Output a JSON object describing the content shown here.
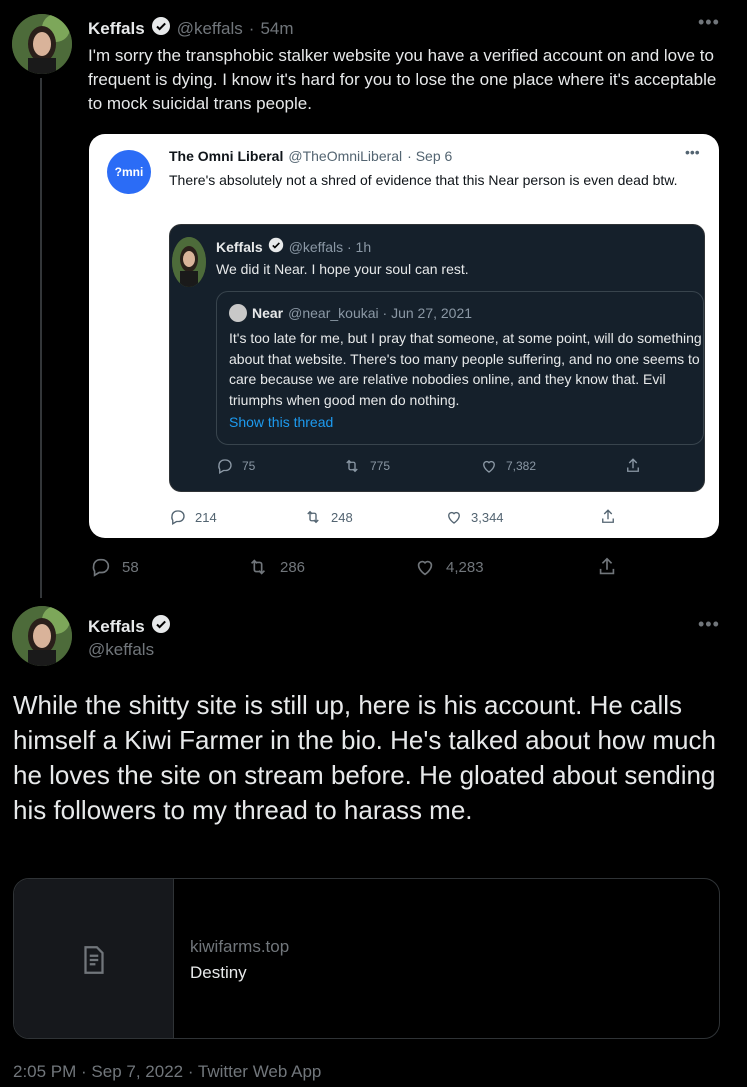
{
  "tweet1": {
    "name": "Keffals",
    "handle": "@keffals",
    "sep": "·",
    "time": "54m",
    "text": "I'm sorry the transphobic stalker website you have a verified account on and love to frequent is dying. I know it's hard for you to lose the one place where it's acceptable to mock suicidal trans people.",
    "replies": "58",
    "retweets": "286",
    "likes": "4,283"
  },
  "quote1": {
    "avatar_text": "?mni",
    "name": "The Omni Liberal",
    "handle": "@TheOmniLiberal",
    "date": "· Sep 6",
    "text": "There's absolutely not a shred of evidence that this Near person is even dead btw.",
    "replies": "214",
    "retweets": "248",
    "likes": "3,344"
  },
  "quote2": {
    "name": "Keffals",
    "handle": "@keffals · 1h",
    "text": "We did it Near. I hope your soul can rest.",
    "replies": "75",
    "retweets": "775",
    "likes": "7,382"
  },
  "quote3": {
    "name": "Near",
    "handle": "@near_koukai · Jun 27, 2021",
    "text": "It's too late for me, but I pray that someone, at some point, will do something about that website. There's too many people suffering, and no one seems to care because we are relative nobodies online, and they know that. Evil triumphs when good men do nothing.",
    "show_thread": "Show this thread"
  },
  "tweet2": {
    "name": "Keffals",
    "handle": "@keffals",
    "text": "While the shitty site is still up, here is his account. He calls himself a Kiwi Farmer in the bio. He's talked about how much he loves the site on stream before. He gloated about sending his followers to my thread to harass me.",
    "link_domain": "kiwifarms.top",
    "link_title": "Destiny",
    "footer": "2:05 PM · Sep 7, 2022 · Twitter Web App"
  },
  "colors": {
    "verified": "#e7e9ea",
    "link_blue": "#1d9bf0",
    "omni_blue": "#2b6cf6"
  }
}
